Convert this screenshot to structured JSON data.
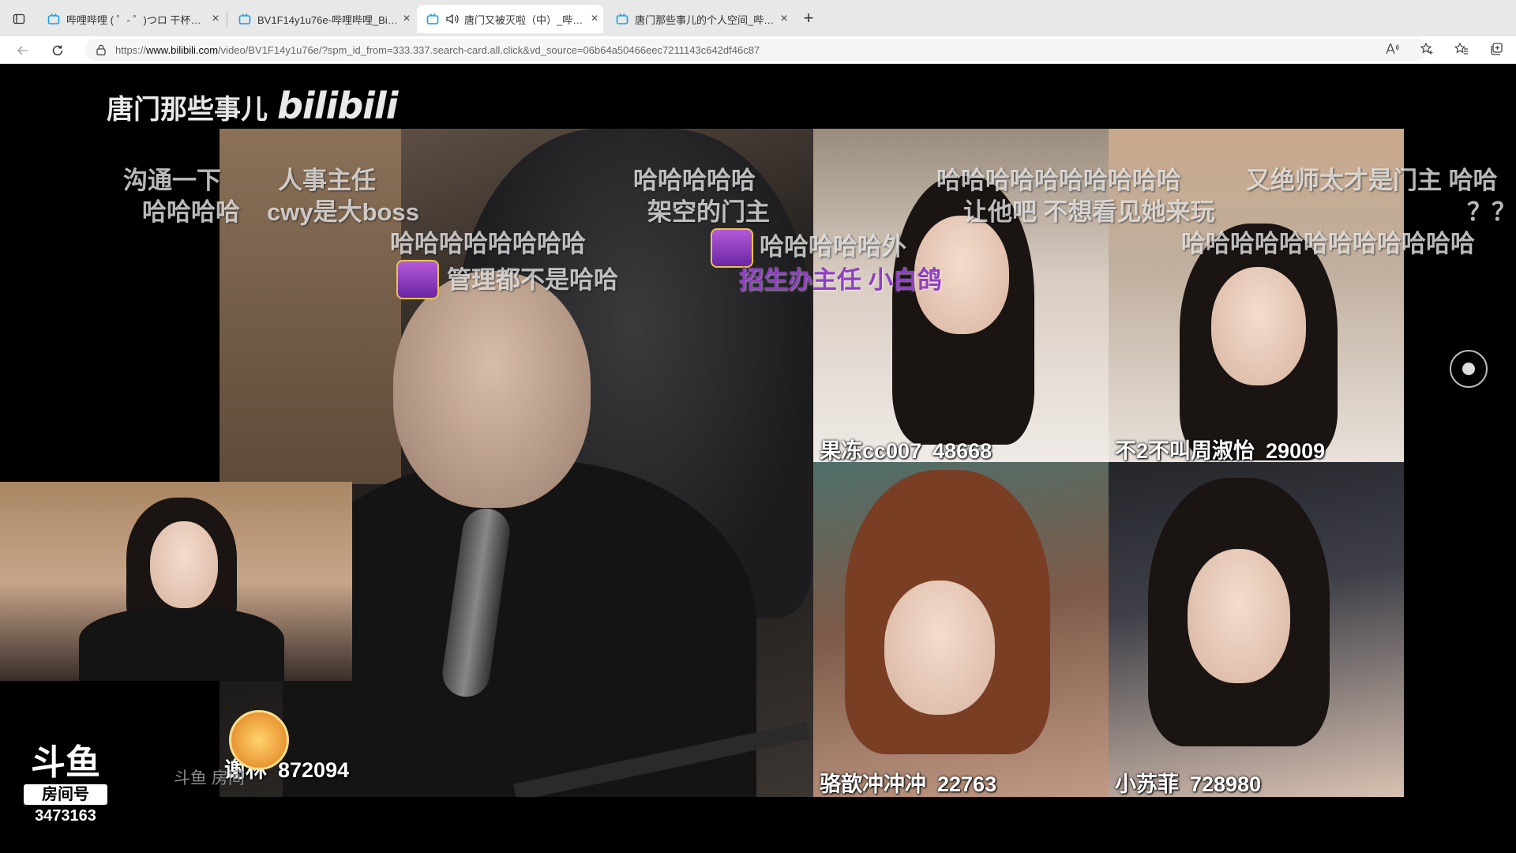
{
  "browser": {
    "tabs": [
      {
        "title": "哔哩哔哩 ( ゜- ゜)つロ 干杯~-bilibili",
        "active": false
      },
      {
        "title": "BV1F14y1u76e-哔哩哔哩_Bilibili",
        "active": false
      },
      {
        "title": "唐门又被灭啦（中）_哔哩哔哩",
        "active": true
      },
      {
        "title": "唐门那些事儿的个人空间_哔哩哔哩",
        "active": false
      }
    ],
    "url_prefix": "https://",
    "url_host": "www.bilibili.com",
    "url_path": "/video/BV1F14y1u76e/?spm_id_from=333.337.search-card.all.click&vd_source=06b64a50466eec7211143c642df46c87",
    "close_glyph": "×",
    "new_tab_glyph": "+"
  },
  "video": {
    "watermark_title": "唐门那些事儿",
    "watermark_brand": "bilibili",
    "cameras": [
      {
        "name": "谢林",
        "id": "872094"
      },
      {
        "name": "果冻cc007",
        "id": "48668"
      },
      {
        "name": "不2不叫周淑怡",
        "id": "29009"
      },
      {
        "name": "骆歆冲冲冲",
        "id": "22763"
      },
      {
        "name": "小苏菲",
        "id": "728980"
      }
    ],
    "danmaku": [
      "沟通一下",
      "人事主任",
      "哈哈哈哈哈",
      "哈哈哈哈哈哈哈哈哈哈",
      "又绝师太才是门主 哈哈",
      "哈哈哈哈",
      "cwy是大boss",
      "架空的门主",
      "让他吧 不想看见她来玩",
      "？？",
      "哈哈哈哈哈哈哈哈",
      "哈哈哈哈哈外",
      "哈哈哈哈哈哈哈哈哈哈哈哈",
      "管理都不是哈哈",
      "招生办主任 小白鸽"
    ],
    "douyu_logo": "斗鱼",
    "room_label": "房间号",
    "room_number": "3473163",
    "room_caption": "斗鱼 房间"
  },
  "colors": {
    "tab_bar": "#e8e8e8",
    "danmaku_purple": "#8e3fc4"
  }
}
